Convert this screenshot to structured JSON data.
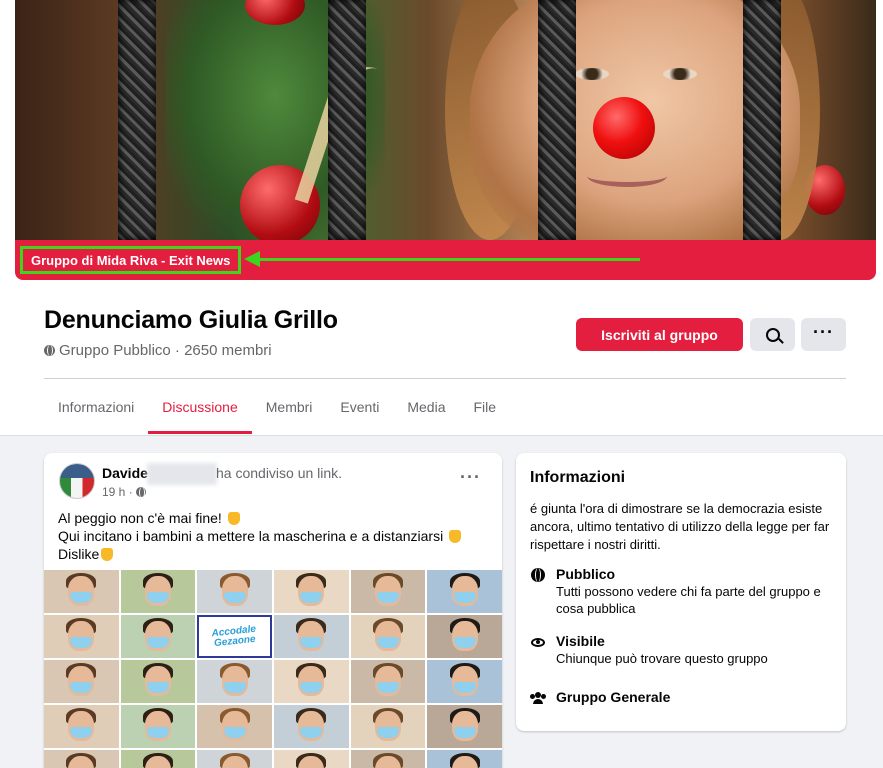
{
  "cover": {
    "group_link": "Gruppo di Mida Riva - Exit News",
    "accent_color": "#e41e3f",
    "highlight_color": "#3ed51e"
  },
  "header": {
    "title": "Denunciamo Giulia Grillo",
    "meta": "Gruppo Pubblico · 2650 membri",
    "join_label": "Iscriviti al gruppo",
    "search_icon": "search-icon",
    "more_icon": "more-icon"
  },
  "tabs": [
    {
      "label": "Informazioni",
      "active": false
    },
    {
      "label": "Discussione",
      "active": true
    },
    {
      "label": "Membri",
      "active": false
    },
    {
      "label": "Eventi",
      "active": false
    },
    {
      "label": "Media",
      "active": false
    },
    {
      "label": "File",
      "active": false
    }
  ],
  "post": {
    "author": "Davide",
    "action": "ha condiviso un link.",
    "time": "19 h ·",
    "more_label": "···",
    "lines": [
      "Al peggio non c'è mai fine!",
      "Qui incitano i bambini a mettere la mascherina e a distanziarsi",
      "Dislike"
    ],
    "collage_logo": "Accodale Gezaone"
  },
  "info": {
    "title": "Informazioni",
    "description": "é giunta l'ora di dimostrare se la democrazia esiste ancora, ultimo tentativo di utilizzo della legge per far rispettare i nostri diritti.",
    "public_label": "Pubblico",
    "public_sub": "Tutti possono vedere chi fa parte del gruppo e cosa pubblica",
    "visible_label": "Visibile",
    "visible_sub": "Chiunque può trovare questo gruppo",
    "type_label": "Gruppo Generale"
  }
}
